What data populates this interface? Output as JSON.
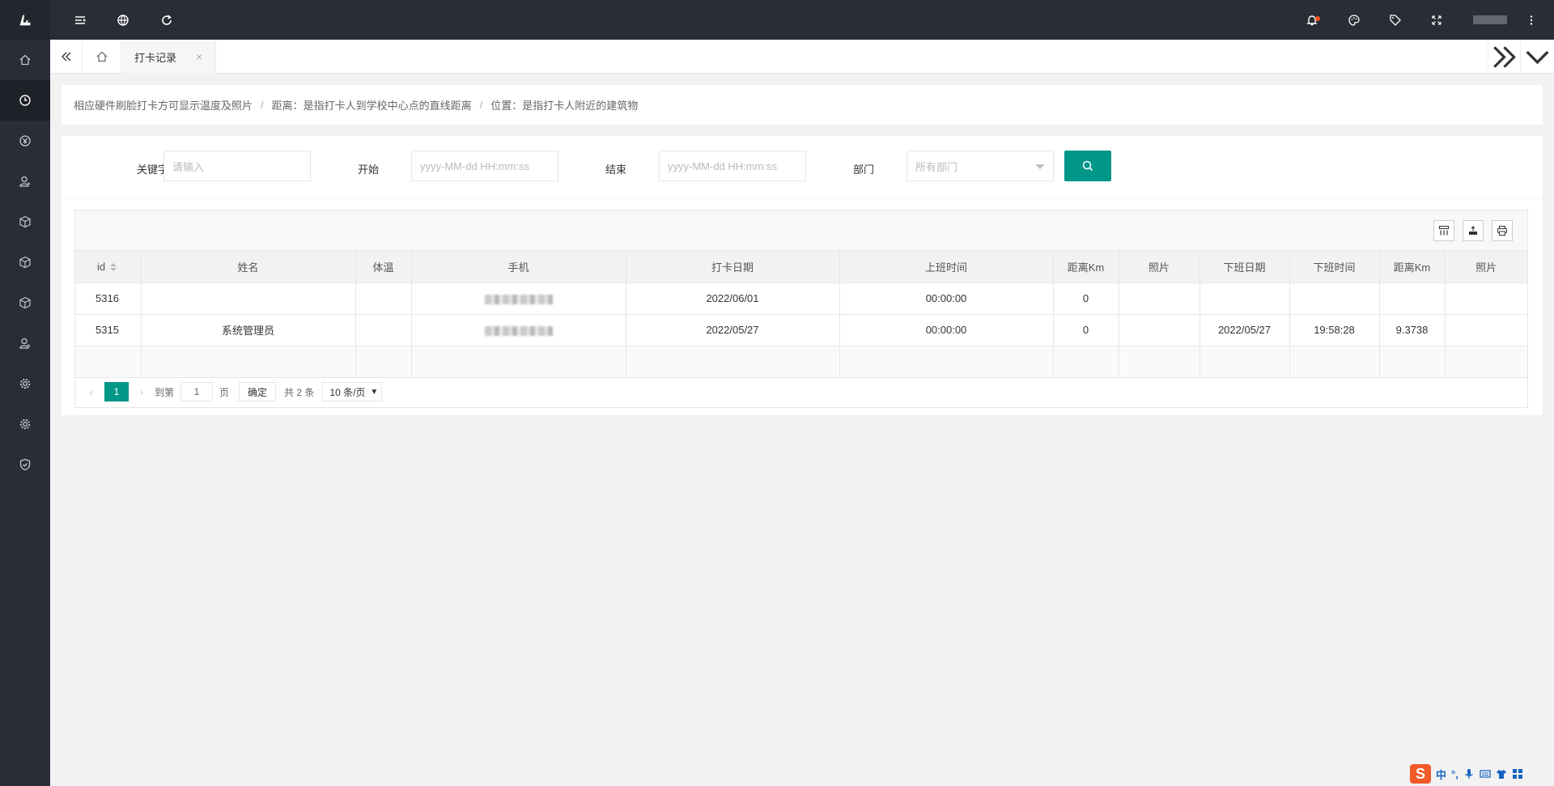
{
  "header": {
    "icons": [
      "hamburger-icon",
      "globe-icon",
      "refresh-icon",
      "bell-icon",
      "palette-icon",
      "tag-icon",
      "fullscreen-icon",
      "more-vertical-icon"
    ]
  },
  "sidebar": {
    "items": [
      "home-icon",
      "clock-icon",
      "yen-icon",
      "user-icon",
      "cube-icon",
      "cube-icon",
      "cube-icon",
      "user-icon",
      "gear-icon",
      "gear-icon",
      "shield-icon"
    ]
  },
  "tabbar": {
    "active_tab": "打卡记录",
    "close_glyph": "×"
  },
  "notice": {
    "item1": "相应硬件刷脸打卡方可显示温度及照片",
    "item2": "距离：是指打卡人到学校中心点的直线距离",
    "item3": "位置：是指打卡人附近的建筑物",
    "sep": "/"
  },
  "search": {
    "keyword_label": "关键字",
    "keyword_placeholder": "请输入",
    "start_label": "开始",
    "start_placeholder": "yyyy-MM-dd HH:mm:ss",
    "end_label": "结束",
    "end_placeholder": "yyyy-MM-dd HH:mm:ss",
    "dept_label": "部门",
    "dept_placeholder": "所有部门"
  },
  "table": {
    "columns": [
      "id",
      "姓名",
      "体温",
      "手机",
      "打卡日期",
      "上班时间",
      "距离Km",
      "照片",
      "下班日期",
      "下班时间",
      "距离Km",
      "照片"
    ],
    "rows": [
      {
        "id": "5316",
        "name": "",
        "temp": "",
        "date": "2022/06/01",
        "in_time": "00:00:00",
        "in_dist": "0",
        "in_photo": "",
        "out_date": "",
        "out_time": "",
        "out_dist": "",
        "out_photo": ""
      },
      {
        "id": "5315",
        "name": "系统管理员",
        "temp": "",
        "date": "2022/05/27",
        "in_time": "00:00:00",
        "in_dist": "0",
        "in_photo": "",
        "out_date": "2022/05/27",
        "out_time": "19:58:28",
        "out_dist": "9.3738",
        "out_photo": ""
      }
    ]
  },
  "pager": {
    "prev": "‹",
    "current": "1",
    "next": "›",
    "goto_label": "到第",
    "goto_value": "1",
    "page_unit": "页",
    "confirm": "确定",
    "total": "共 2 条",
    "page_size": "10 条/页"
  }
}
